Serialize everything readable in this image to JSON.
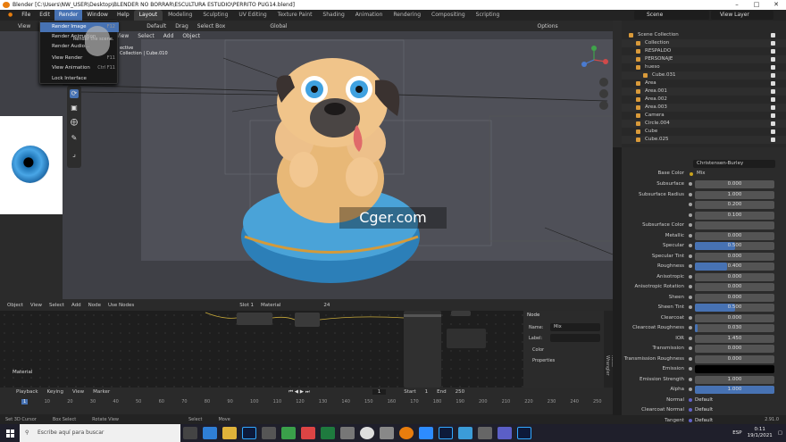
{
  "window": {
    "title": "Blender [C:\\Users\\NW_USER\\Desktop\\BLENDER NO BORRAR\\ESCULTURA ESTUDIO\\PERRITO PUG14.blend]"
  },
  "menubar": {
    "items": [
      "File",
      "Edit",
      "Render",
      "Window",
      "Help"
    ],
    "active": "Render"
  },
  "workspaces": [
    "Layout",
    "Modeling",
    "Sculpting",
    "UV Editing",
    "Texture Paint",
    "Shading",
    "Animation",
    "Rendering",
    "Compositing",
    "Scripting"
  ],
  "active_workspace": "Layout",
  "scene_name": "Scene",
  "view_layer": "View Layer",
  "render_menu": {
    "items": [
      {
        "label": "Render Image",
        "shortcut": "F12",
        "highlight": true
      },
      {
        "label": "Render Animation",
        "shortcut": "",
        "highlight": false
      },
      {
        "label": "Render Audio...",
        "shortcut": "",
        "highlight": false
      },
      {
        "label": "View Render",
        "shortcut": "F11",
        "highlight": false
      },
      {
        "label": "View Animation",
        "shortcut": "Ctrl F11",
        "highlight": false
      },
      {
        "label": "Lock Interface",
        "shortcut": "",
        "highlight": false
      }
    ],
    "tooltip": "Render the scene."
  },
  "viewport": {
    "header_items": [
      "View",
      "Default",
      "Drag",
      "Select Box",
      "Global",
      "Options"
    ],
    "subheader_items": [
      "View",
      "Select",
      "Add",
      "Object"
    ],
    "info_line1": "ective",
    "info_line2": "Collection | Cube.010"
  },
  "watermark": "Cger.com",
  "node_editor": {
    "header": [
      "Object",
      "View",
      "Select",
      "Add",
      "Node",
      "Use Nodes",
      "Slot 1",
      "Material"
    ],
    "slot_count": "24",
    "label": "Material",
    "panel": {
      "title": "Node",
      "name_label": "Name:",
      "name_value": "Mix",
      "label_label": "Label:",
      "color_label": "Color",
      "properties_label": "Properties"
    },
    "side_tab": "Node Wrangler"
  },
  "timeline": {
    "header": [
      "Playback",
      "Keying",
      "View",
      "Marker"
    ],
    "current_frame": "1",
    "start_label": "Start",
    "start": "1",
    "end_label": "End",
    "end": "250",
    "ticks": [
      "1",
      "10",
      "20",
      "30",
      "40",
      "50",
      "60",
      "70",
      "80",
      "90",
      "100",
      "110",
      "120",
      "130",
      "140",
      "150",
      "160",
      "170",
      "180",
      "190",
      "200",
      "210",
      "220",
      "230",
      "240",
      "250"
    ]
  },
  "statusbar": {
    "items": [
      "Set 3D Cursor",
      "Box Select",
      "Rotate View",
      "Select",
      "Move"
    ],
    "version": "2.91.0"
  },
  "outliner": {
    "rows": [
      {
        "label": "Scene Collection",
        "indent": 0
      },
      {
        "label": "Collection",
        "indent": 1
      },
      {
        "label": "RESPALDO",
        "indent": 1
      },
      {
        "label": "PERSONAJE",
        "indent": 1
      },
      {
        "label": "hueso",
        "indent": 1
      },
      {
        "label": "Cube.031",
        "indent": 2
      },
      {
        "label": "Area",
        "indent": 1
      },
      {
        "label": "Area.001",
        "indent": 1
      },
      {
        "label": "Area.002",
        "indent": 1
      },
      {
        "label": "Area.003",
        "indent": 1
      },
      {
        "label": "Camera",
        "indent": 1
      },
      {
        "label": "Circle.004",
        "indent": 1
      },
      {
        "label": "Cube",
        "indent": 1
      },
      {
        "label": "Cube.025",
        "indent": 1
      }
    ]
  },
  "properties": {
    "shader": "Christensen-Burley",
    "base_color_label": "Base Color",
    "base_color_value": "Mix",
    "rows": [
      {
        "label": "Subsurface",
        "value": "0.000",
        "fill": 0
      },
      {
        "label": "Subsurface Radius",
        "value": "1.000",
        "fill": 0
      },
      {
        "label": "",
        "value": "0.200",
        "fill": 0
      },
      {
        "label": "",
        "value": "0.100",
        "fill": 0
      },
      {
        "label": "Subsurface Color",
        "value": "",
        "fill": 0
      },
      {
        "label": "Metallic",
        "value": "0.000",
        "fill": 0
      },
      {
        "label": "Specular",
        "value": "0.500",
        "fill": 0.5
      },
      {
        "label": "Specular Tint",
        "value": "0.000",
        "fill": 0
      },
      {
        "label": "Roughness",
        "value": "0.400",
        "fill": 0.4
      },
      {
        "label": "Anisotropic",
        "value": "0.000",
        "fill": 0
      },
      {
        "label": "Anisotropic Rotation",
        "value": "0.000",
        "fill": 0
      },
      {
        "label": "Sheen",
        "value": "0.000",
        "fill": 0
      },
      {
        "label": "Sheen Tint",
        "value": "0.500",
        "fill": 0.5
      },
      {
        "label": "Clearcoat",
        "value": "0.000",
        "fill": 0
      },
      {
        "label": "Clearcoat Roughness",
        "value": "0.030",
        "fill": 0.03
      },
      {
        "label": "IOR",
        "value": "1.450",
        "fill": 0
      },
      {
        "label": "Transmission",
        "value": "0.000",
        "fill": 0
      },
      {
        "label": "Transmission Roughness",
        "value": "0.000",
        "fill": 0
      },
      {
        "label": "Emission",
        "value": "",
        "fill": 0
      },
      {
        "label": "Emission Strength",
        "value": "1.000",
        "fill": 0
      },
      {
        "label": "Alpha",
        "value": "1.000",
        "fill": 1
      },
      {
        "label": "Normal",
        "value": "Default",
        "fill": 0
      },
      {
        "label": "Clearcoat Normal",
        "value": "Default",
        "fill": 0
      },
      {
        "label": "Tangent",
        "value": "Default",
        "fill": 0
      }
    ]
  },
  "taskbar": {
    "search_placeholder": "Escribe aquí para buscar",
    "language": "ESP",
    "time": "0:11",
    "date": "19/1/2021"
  },
  "colors": {
    "accent": "#4772b3",
    "blender_orange": "#e87d0d"
  }
}
